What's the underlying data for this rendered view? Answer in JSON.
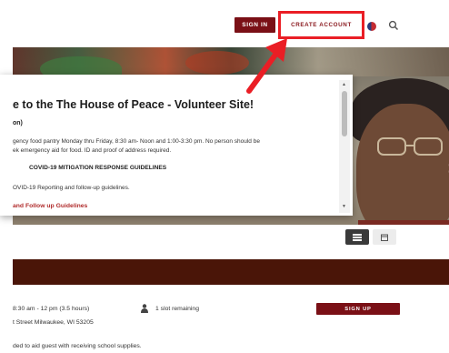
{
  "header": {
    "sign_in_label": "SIGN IN",
    "create_account_label": "CREATE ACCOUNT"
  },
  "modal": {
    "title": "e to the The House of Peace - Volunteer Site!",
    "subtitle": "on)",
    "line1": "gency food pantry Monday thru Friday, 8:30 am- Noon and 1:00-3:30 pm.  No person should be",
    "line2": "ek emergency aid for food. ID and proof of address required.",
    "heading": "COVID-19 MITIGATION RESPONSE GUIDELINES",
    "line3": "OVID-19 Reporting and follow-up guidelines.",
    "link": "and Follow up Guidelines"
  },
  "shift": {
    "time": "8:30 am - 12 pm (3.5 hours)",
    "address": "t Street Milwaukee, WI 53205",
    "slots": "1 slot remaining",
    "signup_label": "SIGN UP",
    "description": "ded to aid guest with receiving school supplies."
  },
  "colors": {
    "brand": "#7a1016",
    "highlight": "#ea1e25",
    "strip": "#4a1508"
  },
  "icons": [
    "flag-icon",
    "search-icon",
    "list-view-icon",
    "calendar-icon",
    "user-icon",
    "chevron-right-icon"
  ]
}
